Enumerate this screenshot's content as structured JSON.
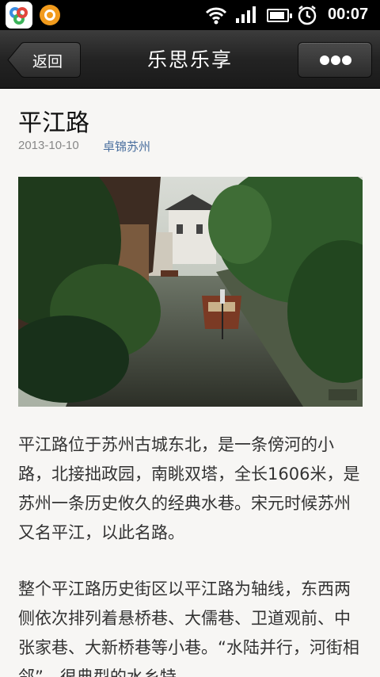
{
  "status_bar": {
    "time": "00:07",
    "icons": [
      "multi-ring-app-icon",
      "orange-browser-icon",
      "wifi-icon",
      "signal-icon",
      "battery-icon",
      "alarm-icon"
    ]
  },
  "header": {
    "back_label": "返回",
    "title": "乐思乐享",
    "more_icon": "more-dots-icon"
  },
  "article": {
    "title": "平江路",
    "date": "2013-10-10",
    "source": "卓锦苏州",
    "paragraphs": [
      "平江路位于苏州古城东北，是一条傍河的小路，北接拙政园，南眺双塔，全长1606米，是苏州一条历史攸久的经典水巷。宋元时候苏州又名平江，以此名路。",
      "整个平江路历史街区以平江路为轴线，东西两侧依次排列着悬桥巷、大儒巷、卫道观前、中张家巷、大新桥巷等小巷。“水陆并行，河街相邻”，很典型的水乡特"
    ]
  },
  "colors": {
    "status_bg": "#000000",
    "titlebar_bg": "#232323",
    "source_link": "#4a6f9e",
    "page_bg": "#f7f6f4"
  }
}
